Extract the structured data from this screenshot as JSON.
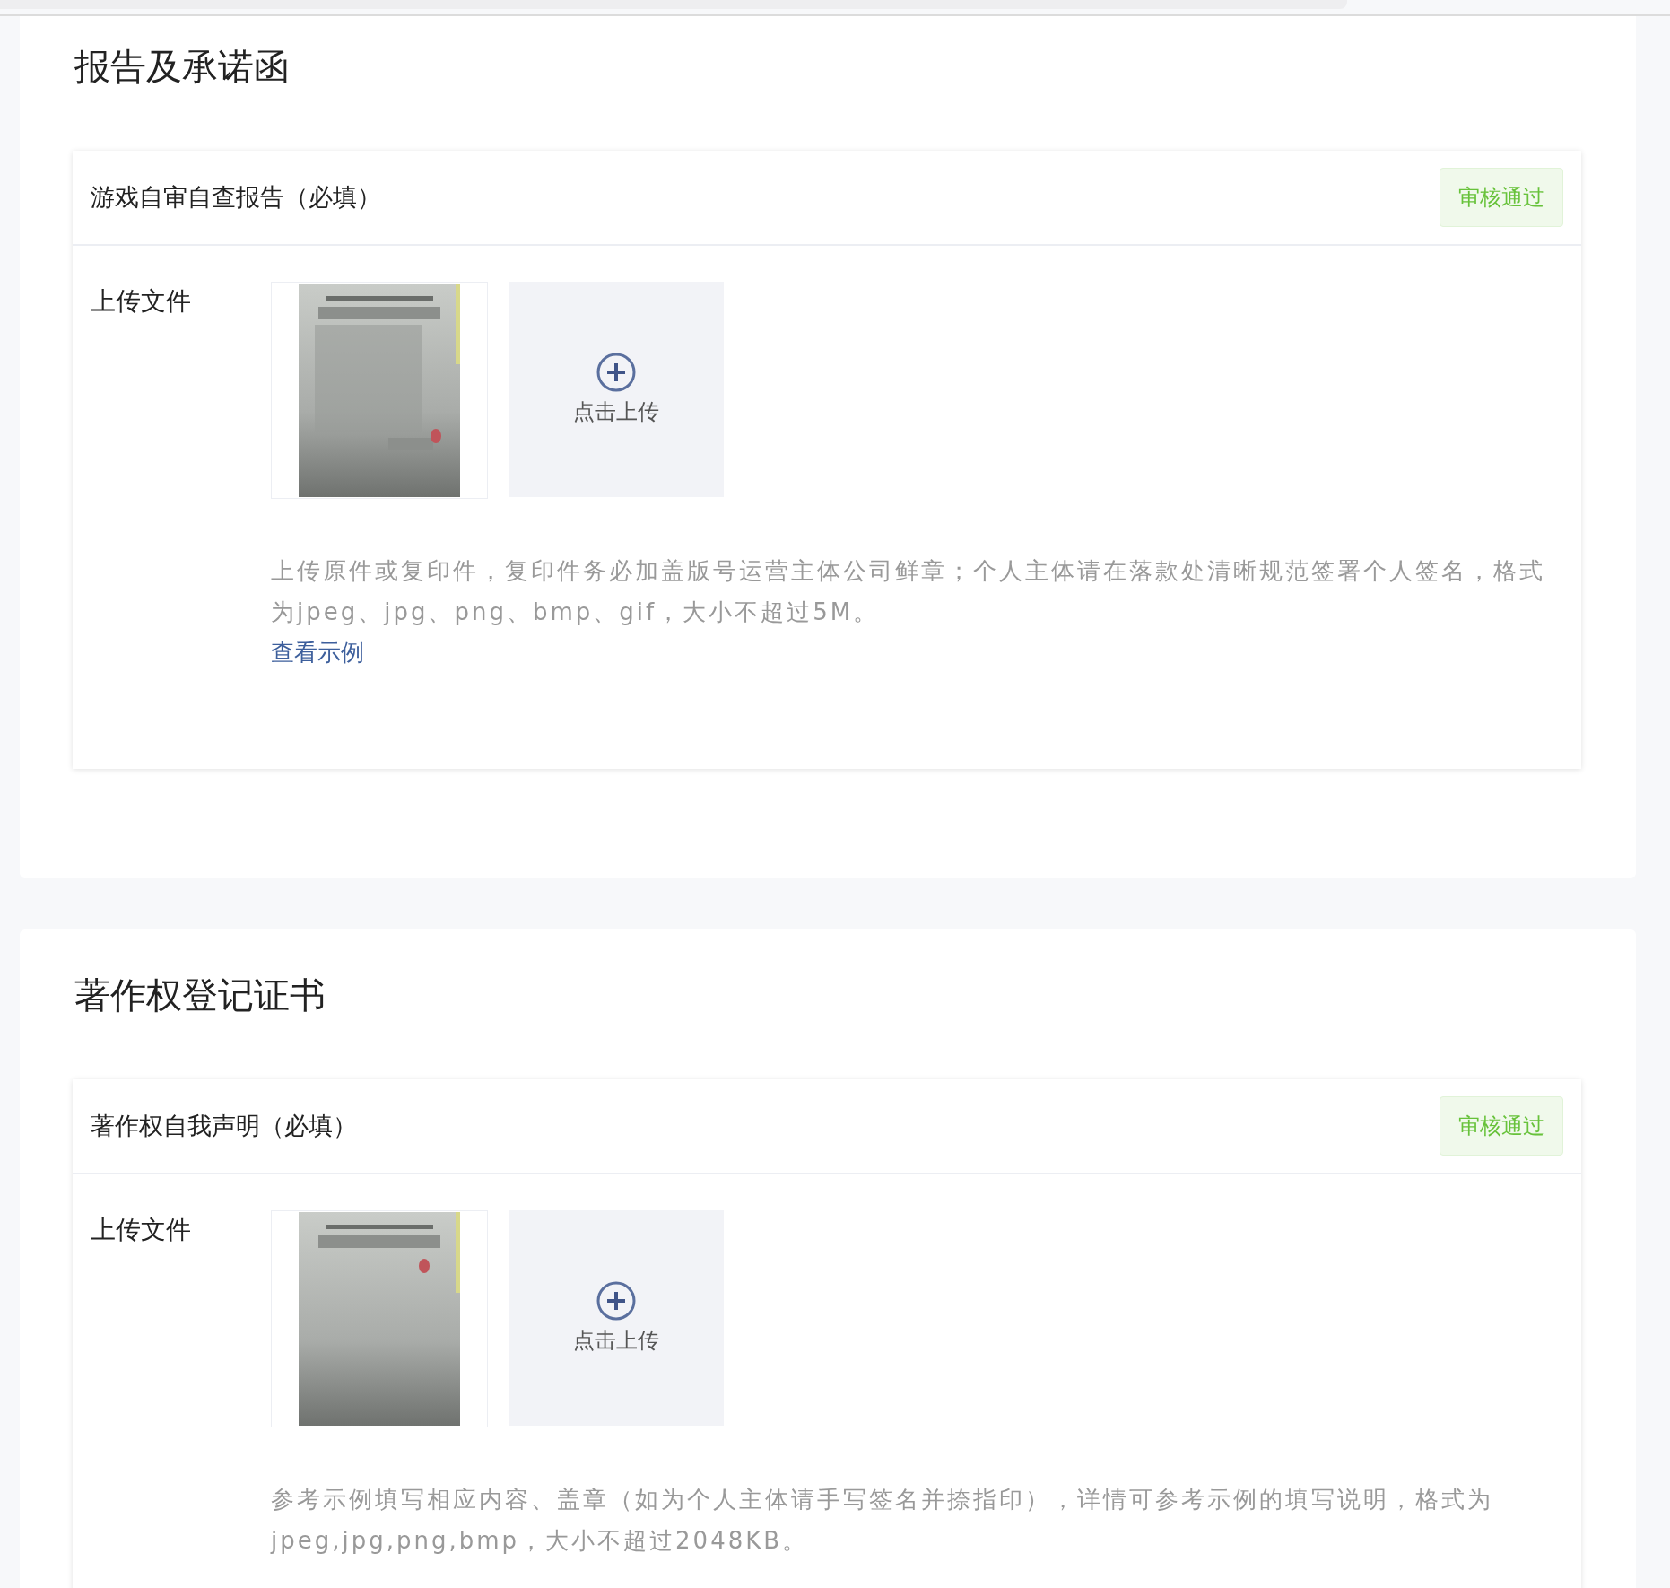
{
  "sections": [
    {
      "title": "报告及承诺函",
      "items": [
        {
          "name": "游戏自审自查报告（必填）",
          "status": "审核通过",
          "field_label": "上传文件",
          "upload_label": "点击上传",
          "help": "上传原件或复印件，复印件务必加盖版号运营主体公司鲜章；个人主体请在落款处清晰规范签署个人签名，格式为jpeg、jpg、png、bmp、gif，大小不超过5M。",
          "link": "查看示例"
        }
      ]
    },
    {
      "title": "著作权登记证书",
      "items": [
        {
          "name": "著作权自我声明（必填）",
          "status": "审核通过",
          "field_label": "上传文件",
          "upload_label": "点击上传",
          "help": "参考示例填写相应内容、盖章（如为个人主体请手写签名并捺指印），详情可参考示例的填写说明，格式为jpeg,jpg,png,bmp，大小不超过2048KB。"
        }
      ]
    }
  ]
}
